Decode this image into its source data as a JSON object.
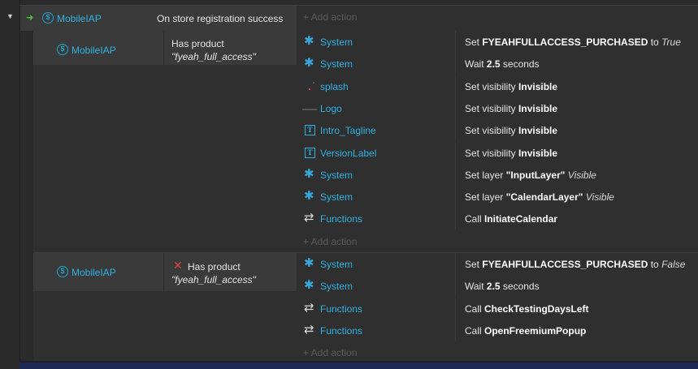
{
  "event": {
    "object": "MobileIAP",
    "condition": "On store registration success",
    "add_action": "+ Add action"
  },
  "sub_events": [
    {
      "object": "MobileIAP",
      "condition_label": "Has product",
      "condition_param": "\"fyeah_full_access\"",
      "inverted": false,
      "actions": [
        {
          "icon": "gear-icon",
          "object": "System",
          "pre": "Set ",
          "bold": "FYEAHFULLACCESS_PURCHASED",
          "mid": " to ",
          "ital": "True"
        },
        {
          "icon": "gear-icon",
          "object": "System",
          "pre": "Wait ",
          "bold": "2.5",
          "mid": " seconds",
          "ital": ""
        },
        {
          "icon": "sprite-icon",
          "object": "splash",
          "pre": "Set visibility ",
          "bold": "Invisible",
          "mid": "",
          "ital": ""
        },
        {
          "icon": "sprite-icon",
          "object": "Logo",
          "pre": "Set visibility ",
          "bold": "Invisible",
          "mid": "",
          "ital": ""
        },
        {
          "icon": "text-icon",
          "object": "Intro_Tagline",
          "pre": "Set visibility ",
          "bold": "Invisible",
          "mid": "",
          "ital": ""
        },
        {
          "icon": "text-icon",
          "object": "VersionLabel",
          "pre": "Set visibility ",
          "bold": "Invisible",
          "mid": "",
          "ital": ""
        },
        {
          "icon": "gear-icon",
          "object": "System",
          "pre": "Set layer ",
          "bold": "\"InputLayer\"",
          "mid": " ",
          "ital": "Visible"
        },
        {
          "icon": "gear-icon",
          "object": "System",
          "pre": "Set layer ",
          "bold": "\"CalendarLayer\"",
          "mid": " ",
          "ital": "Visible"
        },
        {
          "icon": "functions-icon",
          "object": "Functions",
          "pre": "Call ",
          "bold": "InitiateCalendar",
          "mid": "",
          "ital": ""
        }
      ],
      "add_action": "+ Add action"
    },
    {
      "object": "MobileIAP",
      "condition_label": "Has product",
      "condition_param": "\"fyeah_full_access\"",
      "inverted": true,
      "actions": [
        {
          "icon": "gear-icon",
          "object": "System",
          "pre": "Set ",
          "bold": "FYEAHFULLACCESS_PURCHASED",
          "mid": " to ",
          "ital": "False"
        },
        {
          "icon": "gear-icon",
          "object": "System",
          "pre": "Wait ",
          "bold": "2.5",
          "mid": " seconds",
          "ital": ""
        },
        {
          "icon": "functions-icon",
          "object": "Functions",
          "pre": "Call ",
          "bold": "CheckTestingDaysLeft",
          "mid": "",
          "ital": ""
        },
        {
          "icon": "functions-icon",
          "object": "Functions",
          "pre": "Call ",
          "bold": "OpenFreemiumPopup",
          "mid": "",
          "ital": ""
        }
      ],
      "add_action": "+ Add action"
    }
  ],
  "colors": {
    "accent": "#2fb2e4",
    "trigger_arrow": "#3fcf3f",
    "invert_x": "#e04040"
  }
}
